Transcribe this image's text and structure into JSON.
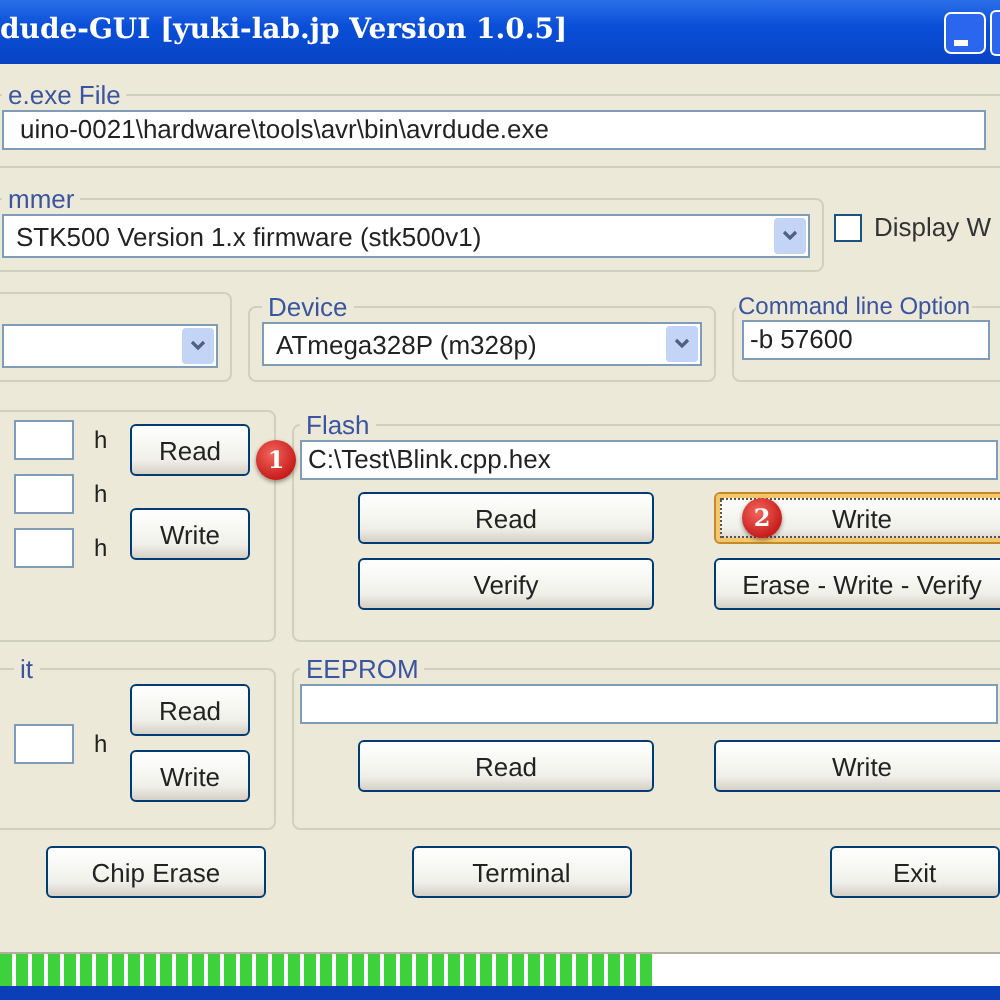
{
  "window": {
    "title": "dude-GUI [yuki-lab.jp Version 1.0.5]"
  },
  "avrdude_file": {
    "label": "e.exe File",
    "value": "uino-0021\\hardware\\tools\\avr\\bin\\avrdude.exe"
  },
  "programmer": {
    "label": "mmer",
    "value": "STK500 Version 1.x firmware (stk500v1)"
  },
  "display_option": {
    "label": "Display W",
    "checked": false
  },
  "device": {
    "label": "Device",
    "value": "ATmega328P (m328p)"
  },
  "command_line": {
    "label": "Command line Option",
    "value": "-b 57600"
  },
  "fuse": {
    "units": [
      "h",
      "h",
      "h"
    ],
    "buttons": [
      "Read",
      "Write"
    ]
  },
  "flash": {
    "label": "Flash",
    "path": "C:\\Test\\Blink.cpp.hex",
    "path_marker": "1",
    "buttons": [
      {
        "label": "Read",
        "focused": false
      },
      {
        "label": "Write",
        "focused": true,
        "marker": "2"
      },
      {
        "label": "Verify",
        "focused": false
      },
      {
        "label": "Erase - Write - Verify",
        "focused": false
      }
    ]
  },
  "lock_bit": {
    "label": "it",
    "unit": "h",
    "buttons": [
      "Read",
      "Write"
    ]
  },
  "eeprom": {
    "label": "EEPROM",
    "buttons": [
      "Read",
      "Write"
    ]
  },
  "actions": [
    "Chip Erase",
    "Terminal",
    "Exit"
  ],
  "progress": {
    "level": 0.655
  }
}
